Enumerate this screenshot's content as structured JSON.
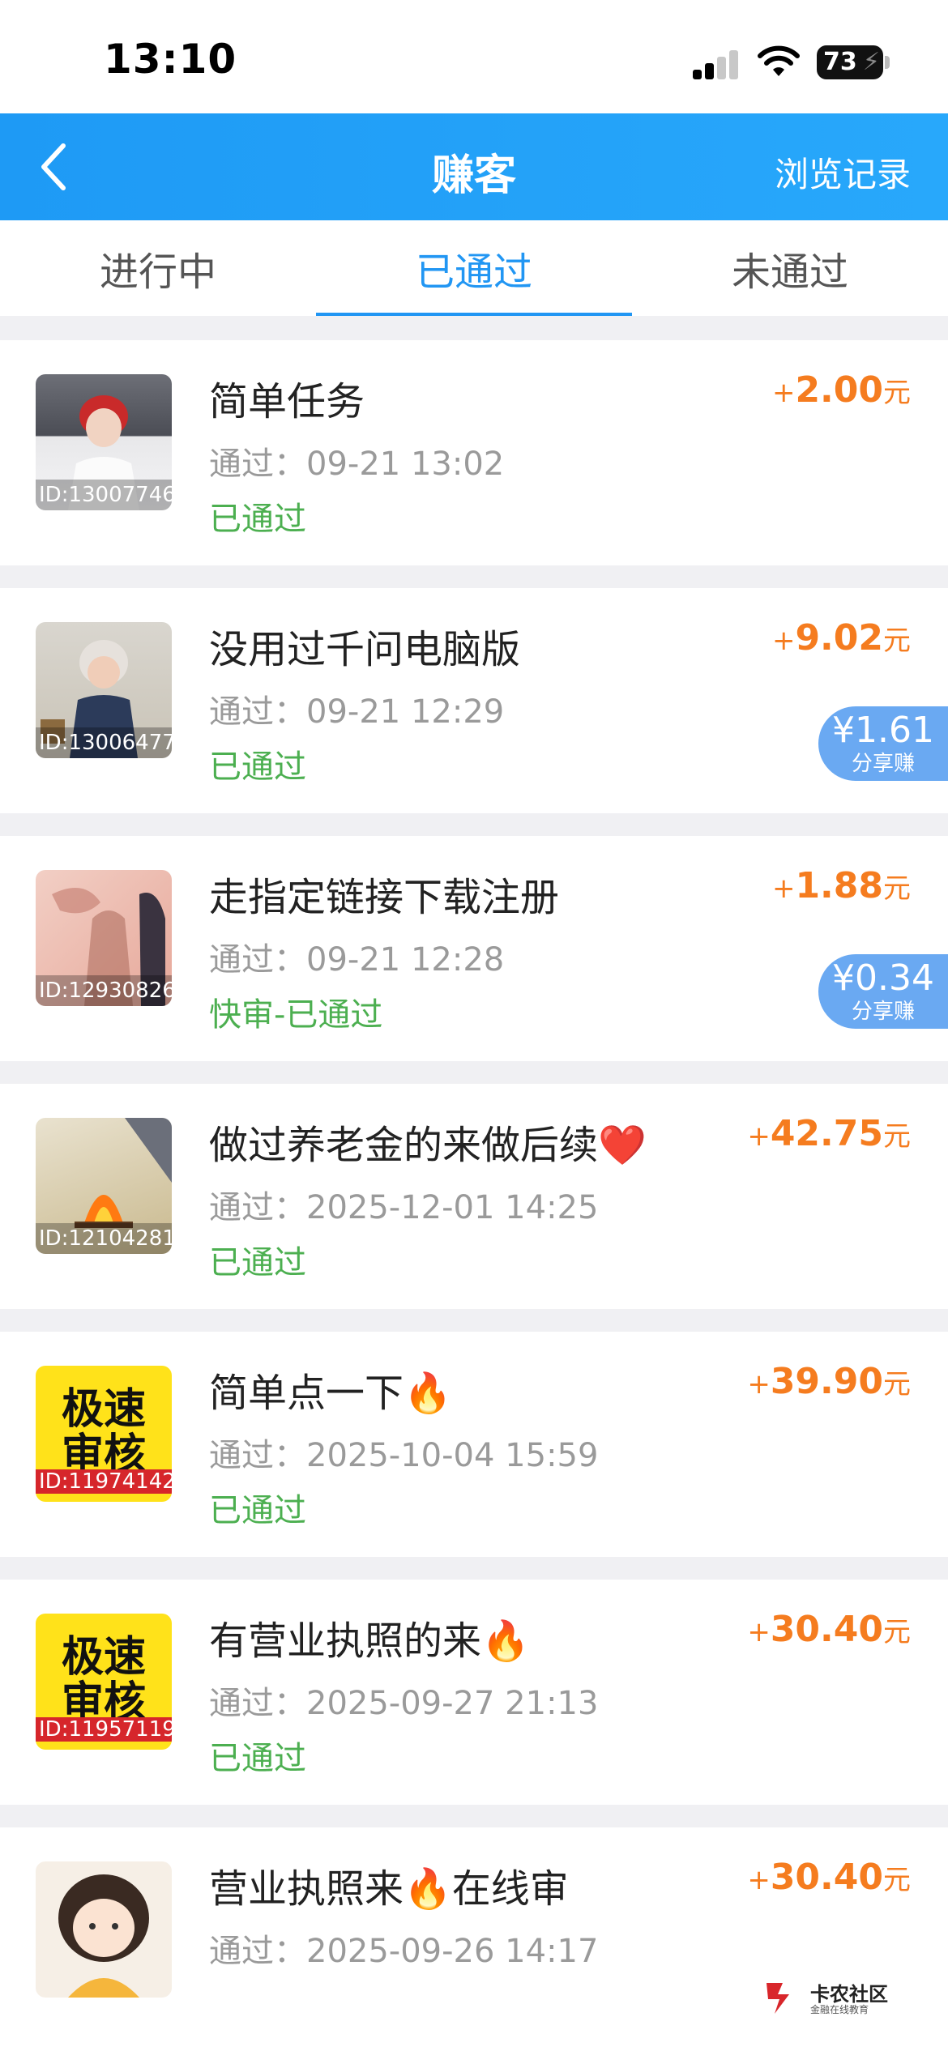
{
  "status_bar": {
    "time": "13:10",
    "battery": "73"
  },
  "nav": {
    "title": "赚客",
    "right_link": "浏览记录"
  },
  "tabs": [
    {
      "label": "进行中",
      "active": false
    },
    {
      "label": "已通过",
      "active": true
    },
    {
      "label": "未通过",
      "active": false
    }
  ],
  "time_prefix": "通过：",
  "items": [
    {
      "title": "简单任务",
      "time": "通过：09-21 13:02",
      "status": "已通过",
      "plus": "+",
      "amount": "2.00",
      "unit": "元",
      "id": "ID:13007746"
    },
    {
      "title": "没用过千问电脑版",
      "time": "通过：09-21 12:29",
      "status": "已通过",
      "plus": "+",
      "amount": "9.02",
      "unit": "元",
      "id": "ID:13006477",
      "share_amount": "¥1.61",
      "share_label": "分享赚"
    },
    {
      "title": "走指定链接下载注册",
      "time": "通过：09-21 12:28",
      "status": "快审-已通过",
      "plus": "+",
      "amount": "1.88",
      "unit": "元",
      "id": "ID:12930826",
      "share_amount": "¥0.34",
      "share_label": "分享赚"
    },
    {
      "title": "做过养老金的来做后续❤️",
      "time": "通过：2025-12-01 14:25",
      "status": "已通过",
      "plus": "+",
      "amount": "42.75",
      "unit": "元",
      "id": "ID:12104281"
    },
    {
      "title": "简单点一下🔥",
      "time": "通过：2025-10-04 15:59",
      "status": "已通过",
      "plus": "+",
      "amount": "39.90",
      "unit": "元",
      "id": "ID:11974142",
      "thumb_text": "极速审核"
    },
    {
      "title": "有营业执照的来🔥",
      "time": "通过：2025-09-27 21:13",
      "status": "已通过",
      "plus": "+",
      "amount": "30.40",
      "unit": "元",
      "id": "ID:11957119",
      "thumb_text": "极速审核"
    },
    {
      "title": "营业执照来🔥在线审",
      "time": "通过：2025-09-26 14:17",
      "status": "",
      "plus": "+",
      "amount": "30.40",
      "unit": "元",
      "id": ""
    }
  ],
  "watermark": {
    "name": "卡农社区",
    "sub": "金融在线教育"
  },
  "colors": {
    "accent": "#2196f3",
    "nav_bg": "#28a8fb",
    "amount": "#f57c1f",
    "status_ok": "#4caf50",
    "share_badge": "#6aa9f2"
  }
}
